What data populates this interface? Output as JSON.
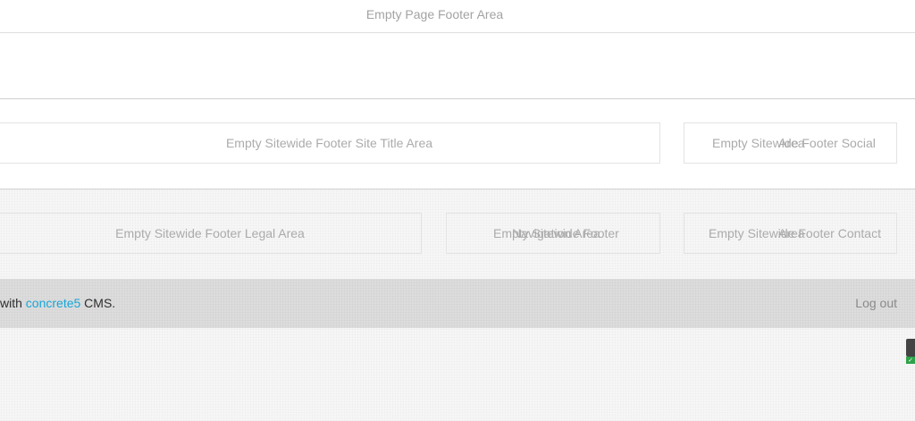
{
  "page_footer": {
    "label": "Empty Page Footer Area"
  },
  "sitewide_footer": {
    "site_title_label": "Empty Sitewide Footer Site Title Area",
    "social": {
      "label_a": "Empty Sitewide Footer Social",
      "label_b": "Area"
    },
    "legal_label": "Empty Sitewide Footer Legal Area",
    "navigation": {
      "label_a": "Empty Sitewide Footer",
      "label_b": "Navigation Area"
    },
    "contact": {
      "label_a": "Empty Sitewide Footer Contact",
      "label_b": "Area"
    }
  },
  "credit_bar": {
    "prefix": "with",
    "link_text": "concrete5",
    "suffix": "CMS.",
    "logout_label": "Log out"
  },
  "edge_widget": {
    "check_icon": "check-icon",
    "check_glyph": "✓",
    "status_color": "#2fa24a"
  },
  "colors": {
    "link": "#16a6d8",
    "placeholder_text": "#ababab"
  }
}
